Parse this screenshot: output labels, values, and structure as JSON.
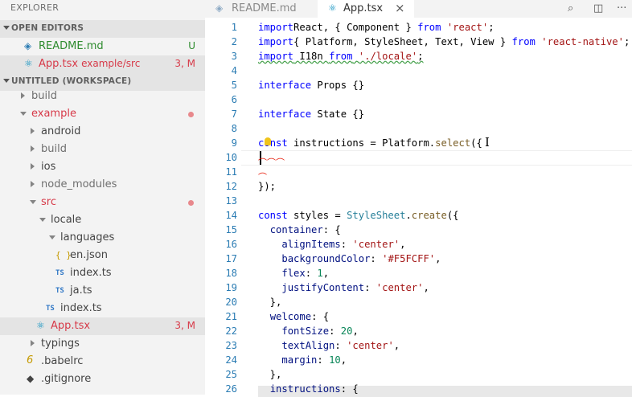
{
  "sidebar": {
    "title": "EXPLORER",
    "open_editors_label": "OPEN EDITORS",
    "workspace_label": "UNTITLED (WORKSPACE)",
    "open_editors": [
      {
        "name": "README.md",
        "sub": "",
        "status": "U"
      },
      {
        "name": "App.tsx",
        "sub": "example/src",
        "status": "3, M"
      }
    ],
    "tree": [
      {
        "name": "build"
      },
      {
        "name": "example"
      },
      {
        "name": "android"
      },
      {
        "name": "build"
      },
      {
        "name": "ios"
      },
      {
        "name": "node_modules"
      },
      {
        "name": "src"
      },
      {
        "name": "locale"
      },
      {
        "name": "languages"
      },
      {
        "name": "en.json",
        "icon": "{ }"
      },
      {
        "name": "index.ts",
        "icon": "TS"
      },
      {
        "name": "ja.ts",
        "icon": "TS"
      },
      {
        "name": "index.ts",
        "icon": "TS"
      },
      {
        "name": "App.tsx",
        "status": "3, M"
      },
      {
        "name": "typings"
      },
      {
        "name": ".babelrc"
      },
      {
        "name": ".gitignore"
      }
    ]
  },
  "tabs": [
    {
      "label": "README.md"
    },
    {
      "label": "App.tsx",
      "close": "×"
    }
  ],
  "toolbar_icons": [
    "search-preview-icon",
    "split-editor-icon",
    "more-actions-icon"
  ],
  "editor": {
    "line_numbers": [
      "1",
      "2",
      "3",
      "4",
      "5",
      "6",
      "7",
      "8",
      "9",
      "10",
      "11",
      "12",
      "13",
      "14",
      "15",
      "16",
      "17",
      "18",
      "19",
      "20",
      "21",
      "22",
      "23",
      "24",
      "25",
      "26"
    ],
    "lines": [
      [
        [
          "kw",
          "import"
        ],
        [
          "",
          "React, { Component } "
        ],
        [
          "kw",
          "from"
        ],
        [
          "",
          " "
        ],
        [
          "str",
          "'react'"
        ],
        [
          "",
          ";"
        ]
      ],
      [
        [
          "kw",
          "import"
        ],
        [
          "",
          "{ Platform, StyleSheet, Text, View } "
        ],
        [
          "kw",
          "from"
        ],
        [
          "",
          " "
        ],
        [
          "str",
          "'react-native'"
        ],
        [
          "",
          ";"
        ]
      ],
      [
        [
          "kwsq",
          "import"
        ],
        [
          "sq",
          " I18n "
        ],
        [
          "kwsq",
          "from"
        ],
        [
          "sq",
          " "
        ],
        [
          "strsq",
          "'./locale'"
        ],
        [
          "sq",
          ";"
        ]
      ],
      [],
      [
        [
          "kw",
          "interface"
        ],
        [
          "",
          " Props {}"
        ]
      ],
      [],
      [
        [
          "kw",
          "interface"
        ],
        [
          "",
          " State {}"
        ]
      ],
      [],
      [
        [
          "kw",
          "co"
        ],
        [
          "kw",
          "nst"
        ],
        [
          "",
          " instructions = Platform."
        ],
        [
          "fn",
          "select"
        ],
        [
          "",
          "({"
        ]
      ],
      [],
      [],
      [
        [
          "",
          "});"
        ]
      ],
      [],
      [
        [
          "kw",
          "const"
        ],
        [
          "",
          " styles = "
        ],
        [
          "ty",
          "StyleSheet"
        ],
        [
          "",
          "."
        ],
        [
          "fn",
          "create"
        ],
        [
          "",
          "({"
        ]
      ],
      [
        [
          "",
          "  "
        ],
        [
          "prop",
          "container"
        ],
        [
          "",
          ": {"
        ]
      ],
      [
        [
          "",
          "    "
        ],
        [
          "prop",
          "alignItems"
        ],
        [
          "",
          ": "
        ],
        [
          "str",
          "'center'"
        ],
        [
          "",
          ","
        ]
      ],
      [
        [
          "",
          "    "
        ],
        [
          "prop",
          "backgroundColor"
        ],
        [
          "",
          ": "
        ],
        [
          "str",
          "'#F5FCFF'"
        ],
        [
          "",
          ","
        ]
      ],
      [
        [
          "",
          "    "
        ],
        [
          "prop",
          "flex"
        ],
        [
          "",
          ": "
        ],
        [
          "num",
          "1"
        ],
        [
          "",
          ","
        ]
      ],
      [
        [
          "",
          "    "
        ],
        [
          "prop",
          "justifyContent"
        ],
        [
          "",
          ": "
        ],
        [
          "str",
          "'center'"
        ],
        [
          "",
          ","
        ]
      ],
      [
        [
          "",
          "  },"
        ]
      ],
      [
        [
          "",
          "  "
        ],
        [
          "prop",
          "welcome"
        ],
        [
          "",
          ": {"
        ]
      ],
      [
        [
          "",
          "    "
        ],
        [
          "prop",
          "fontSize"
        ],
        [
          "",
          ": "
        ],
        [
          "num",
          "20"
        ],
        [
          "",
          ","
        ]
      ],
      [
        [
          "",
          "    "
        ],
        [
          "prop",
          "textAlign"
        ],
        [
          "",
          ": "
        ],
        [
          "str",
          "'center'"
        ],
        [
          "",
          ","
        ]
      ],
      [
        [
          "",
          "    "
        ],
        [
          "prop",
          "margin"
        ],
        [
          "",
          ": "
        ],
        [
          "num",
          "10"
        ],
        [
          "",
          ","
        ]
      ],
      [
        [
          "",
          "  },"
        ]
      ],
      [
        [
          "",
          "  "
        ],
        [
          "prop",
          "instructions"
        ],
        [
          "",
          ": {"
        ]
      ]
    ]
  }
}
